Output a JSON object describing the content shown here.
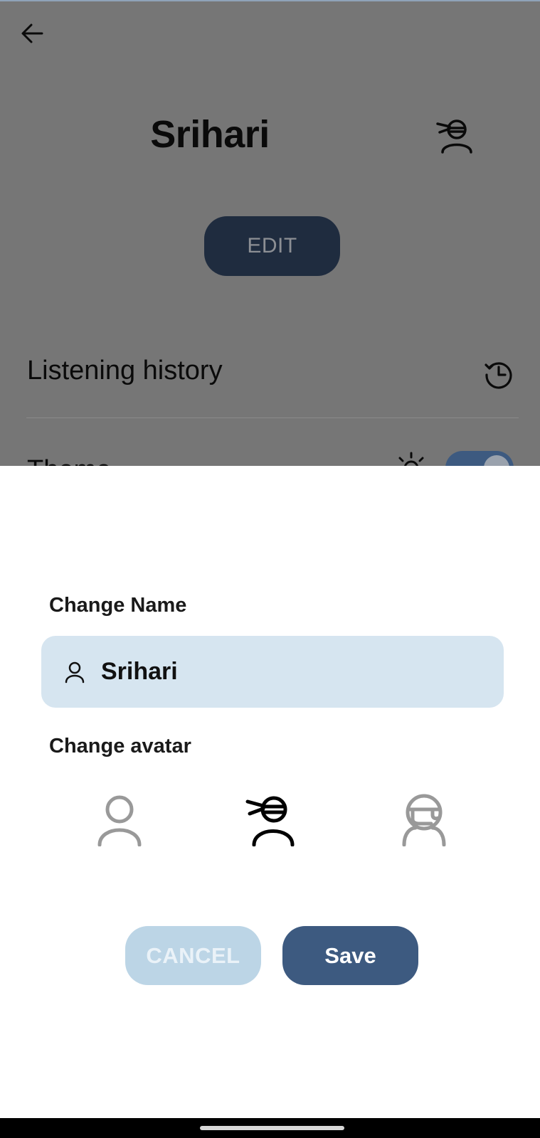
{
  "profile": {
    "name": "Srihari",
    "edit_label": "EDIT",
    "history_label": "Listening history",
    "theme_label": "Theme",
    "theme_toggle_on": true
  },
  "dialog": {
    "change_name_title": "Change Name",
    "name_value": "Srihari",
    "change_avatar_title": "Change avatar",
    "avatars": [
      {
        "icon": "person-icon",
        "selected": false
      },
      {
        "icon": "ninja-icon",
        "selected": true
      },
      {
        "icon": "astronaut-icon",
        "selected": false
      }
    ],
    "cancel_label": "CANCEL",
    "save_label": "Save"
  },
  "colors": {
    "scrim": "#767676",
    "primary": "#3d5a80",
    "field_bg": "#d6e5f0",
    "cancel_bg": "#bcd5e6",
    "edit_bg": "#1f2c3f"
  }
}
